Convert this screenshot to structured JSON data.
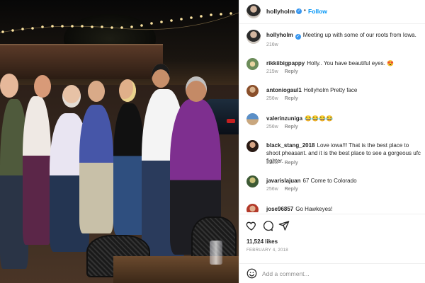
{
  "header": {
    "username": "hollyholm",
    "separator": "•",
    "follow_label": "Follow"
  },
  "caption": {
    "username": "hollyholm",
    "text": "Meeting up with some of our roots from Iowa.",
    "age": "216w"
  },
  "comments": [
    {
      "username": "rikkiibigpappy",
      "text": "Holly.. You have beautiful eyes. 😍",
      "age": "215w",
      "reply": "Reply"
    },
    {
      "username": "antoniogaul1",
      "text": "Hollyholm Pretty face",
      "age": "256w",
      "reply": "Reply"
    },
    {
      "username": "valerinzuniga",
      "text": "😂😂😂😂",
      "age": "256w",
      "reply": "Reply"
    },
    {
      "username": "black_stang_2018",
      "text": "Love iowa!!! That is the best place to shoot pheasant. and it is the best place to see a gorgeous ufc fighter.",
      "age": "256w",
      "reply": "Reply"
    },
    {
      "username": "javarislajuan",
      "text": "67 Come to Colorado",
      "age": "256w",
      "reply": "Reply"
    },
    {
      "username": "jose96857",
      "text": "Go Hawkeyes!",
      "age": "",
      "reply": ""
    }
  ],
  "actions": {
    "likes": "11,524 likes",
    "date": "FEBRUARY 4, 2018"
  },
  "add_comment": {
    "placeholder": "Add a comment..."
  },
  "colors": {
    "link_blue": "#0095f6",
    "verified": "#3897f0",
    "muted": "#8e8e8e"
  },
  "icons": [
    "heart-icon",
    "comment-icon",
    "share-icon",
    "smiley-icon",
    "verified-icon"
  ]
}
